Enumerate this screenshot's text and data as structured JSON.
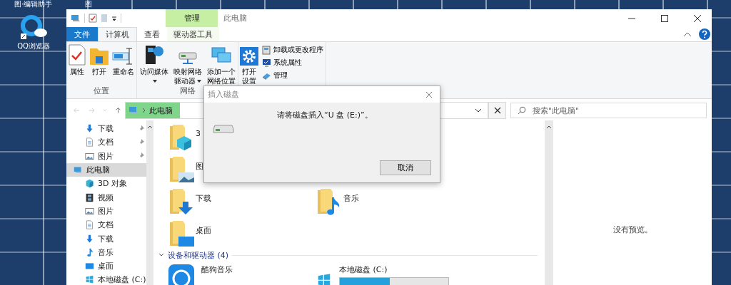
{
  "desktop": {
    "top_texts": [
      "图·编辑助手",
      "图"
    ],
    "icons": [
      {
        "label": "QQ浏览器"
      }
    ]
  },
  "window": {
    "title": "此电脑",
    "contextual_tab": "管理"
  },
  "ribbon": {
    "tabs": [
      {
        "label": "文件",
        "kind": "file",
        "selected": false
      },
      {
        "label": "计算机",
        "kind": "tab",
        "selected": true
      },
      {
        "label": "查看",
        "kind": "tab",
        "selected": false
      },
      {
        "label": "驱动器工具",
        "kind": "context",
        "selected": false
      }
    ],
    "groups": [
      {
        "label": "位置",
        "buttons": [
          {
            "label": "属性",
            "kind": "properties",
            "dropdown": false
          },
          {
            "label": "打开",
            "kind": "open",
            "dropdown": false
          },
          {
            "label": "重命名",
            "kind": "rename",
            "dropdown": false
          }
        ]
      },
      {
        "label": "网络",
        "buttons": [
          {
            "label": "访问媒体",
            "kind": "media",
            "dropdown": true
          },
          {
            "label": "映射网络驱动器",
            "kind": "drive",
            "dropdown": true
          },
          {
            "label": "添加一个网络位置",
            "kind": "network",
            "dropdown": false
          }
        ]
      },
      {
        "buttons": [
          {
            "label": "打开设置",
            "kind": "settings",
            "dropdown": false
          }
        ],
        "small_buttons": [
          {
            "label": "卸载或更改程序",
            "kind": "uninstall"
          },
          {
            "label": "系统属性",
            "kind": "system"
          },
          {
            "label": "管理",
            "kind": "manage"
          }
        ]
      }
    ]
  },
  "address_bar": {
    "crumbs": [
      "此电脑"
    ]
  },
  "search": {
    "placeholder": "搜索\"此电脑\""
  },
  "nav_pane": {
    "quick_access": [
      {
        "label": "下载",
        "kind": "download",
        "pinned": true,
        "selected": false
      },
      {
        "label": "文档",
        "kind": "document",
        "pinned": true,
        "selected": false
      },
      {
        "label": "图片",
        "kind": "picture",
        "pinned": true,
        "selected": false
      }
    ],
    "tree": [
      {
        "label": "此电脑",
        "kind": "pc",
        "selected": true,
        "children": [
          {
            "label": "3D 对象",
            "kind": "cube",
            "selected": false
          },
          {
            "label": "视频",
            "kind": "video",
            "selected": false
          },
          {
            "label": "图片",
            "kind": "picture",
            "selected": false
          },
          {
            "label": "文档",
            "kind": "document",
            "selected": false
          },
          {
            "label": "下载",
            "kind": "download",
            "selected": false
          },
          {
            "label": "音乐",
            "kind": "music",
            "selected": false
          },
          {
            "label": "桌面",
            "kind": "desktop",
            "selected": false
          },
          {
            "label": "本地磁盘 (C:)",
            "kind": "disk",
            "selected": false
          }
        ]
      }
    ]
  },
  "folder_rows": [
    [
      {
        "label": "3",
        "kind": "cube"
      }
    ],
    [
      {
        "label": "图",
        "kind": "picture"
      }
    ],
    [
      {
        "label": "下载",
        "kind": "download"
      },
      {
        "label": "音乐",
        "kind": "music"
      }
    ],
    [
      {
        "label": "桌面",
        "kind": "desktop"
      }
    ]
  ],
  "devices": {
    "label": "设备和驱动器 (4)",
    "expanded": true,
    "items": [
      {
        "label": "酷狗音乐",
        "kind": "app"
      },
      {
        "label": "本地磁盘 (C:)",
        "kind": "disk",
        "level": 0.46
      }
    ]
  },
  "preview": {
    "text": "没有预览。"
  },
  "dialog": {
    "title": "插入磁盘",
    "message": "请将磁盘插入“U 盘 (E:)”。",
    "buttons": [
      "取消"
    ]
  }
}
